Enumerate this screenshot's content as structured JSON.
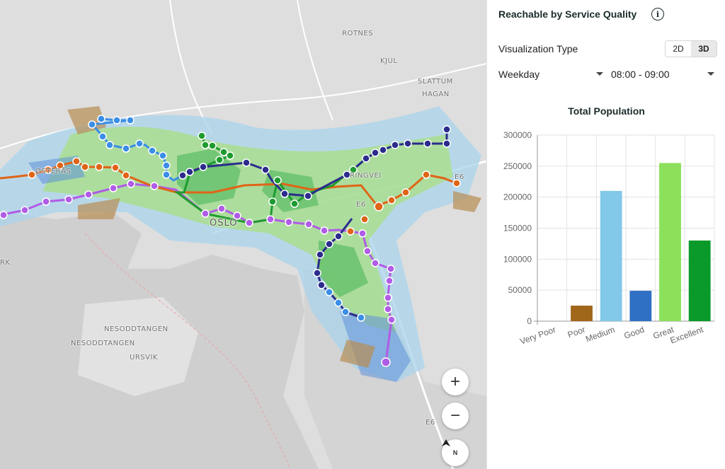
{
  "map": {
    "labels": {
      "rotnes": "ROTNES",
      "kjul": "KJUL",
      "slattum": "SLATTUM",
      "hagan": "HAGAN",
      "osteras": "ØSTERÅS",
      "oslo": "OSLO",
      "nesoddtangen": "NESODDTANGEN",
      "ursvik": "URSVIK",
      "rk": "RK",
      "e6_a": "E6",
      "e6_b": "E6",
      "e6_c": "E6",
      "ringvei": "RINGVEI"
    },
    "controls": {
      "zoom_in": "+",
      "zoom_out": "−",
      "compass": "N"
    }
  },
  "panel": {
    "title": "Reachable by Service Quality",
    "info_icon": "i",
    "visualization_label": "Visualization Type",
    "toggle_2d": "2D",
    "toggle_3d": "3D",
    "toggle_selected": "3D",
    "day_select": "Weekday",
    "time_select": "08:00 - 09:00"
  },
  "colors": {
    "very_poor": "#a0a0a0",
    "poor": "#a0661a",
    "medium": "#82c8e8",
    "good": "#3070c4",
    "great": "#8ce05a",
    "excellent": "#0a9a2a",
    "line_green": "#1e9b2e",
    "line_navy": "#2b2c8c",
    "line_blue": "#3a8ee6",
    "line_orange": "#e06416",
    "line_purple": "#b05ce6"
  },
  "chart_data": {
    "type": "bar",
    "title": "Total Population",
    "categories": [
      "Very Poor",
      "Poor",
      "Medium",
      "Good",
      "Great",
      "Excellent"
    ],
    "values": [
      0,
      25000,
      210000,
      49000,
      255000,
      130000
    ],
    "ylim": [
      0,
      300000
    ],
    "yticks": [
      0,
      50000,
      100000,
      150000,
      200000,
      250000,
      300000
    ],
    "ytick_labels": [
      "0",
      "50000",
      "100000",
      "150000",
      "200000",
      "250000",
      "300000"
    ],
    "grid": true,
    "legend": "none"
  }
}
